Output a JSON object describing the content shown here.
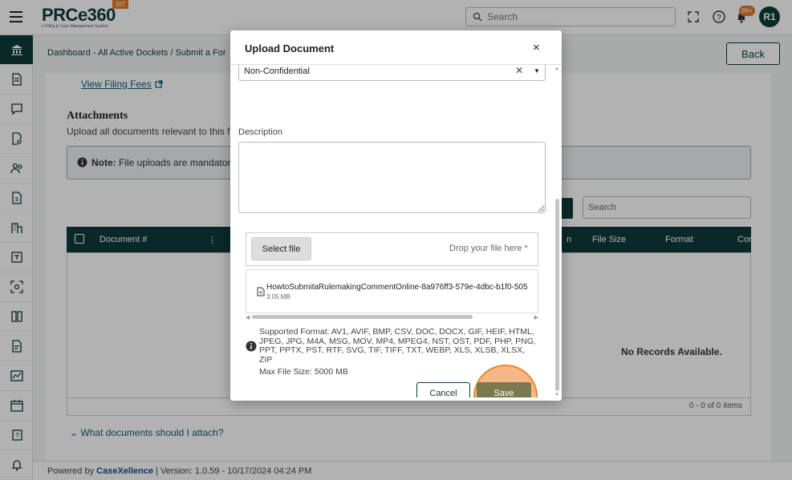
{
  "app": {
    "logo_text": "PRCe360",
    "logo_sub": "e-Filing & Case Management System",
    "env_badge": "SIT"
  },
  "topbar": {
    "search_placeholder": "Search",
    "notification_count": "99+",
    "avatar_initials": "R1"
  },
  "page": {
    "breadcrumb": "Dashboard - All Active Dockets / Submit a For",
    "back_label": "Back",
    "fees_link": "View Filing Fees",
    "attachments_title": "Attachments",
    "attachments_sub": "Upload all documents relevant to this f",
    "note_label": "Note:",
    "note_text": "File uploads are mandatory",
    "grid_search_placeholder": "Search",
    "columns": {
      "doc_num": "Document #",
      "n": "n",
      "file_size": "File Size",
      "format": "Format",
      "cor": "Cor"
    },
    "no_records": "No Records Available.",
    "pager": "0 - 0 of 0 items",
    "what_docs": "What documents should I attach?"
  },
  "footer": {
    "powered_by": "Powered by",
    "brand": "CaseXellence",
    "separator": "|",
    "version": "Version: 1.0.59 - 10/17/2024 04:24 PM"
  },
  "modal": {
    "title": "Upload Document",
    "close": "×",
    "confidentiality_value": "Non-Confidential",
    "description_label": "Description",
    "select_file_label": "Select file",
    "drop_text": "Drop your file here *",
    "file": {
      "name": "HowtoSubmitaRulemakingCommentOnline-8a976ff3-579e-4dbc-b1f0-505",
      "size": "3.05 MB"
    },
    "supported_formats": "Supported Format: AV1, AVIF, BMP, CSV, DOC, DOCX, GIF, HEIF, HTML, JPEG, JPG, M4A, MSG, MOV, MP4, MPEG4, NST, OST, PDF, PHP, PNG, PPT, PPTX, PST, RTF, SVG, TIF, TIFF, TXT, WEBP, XLS, XLSB, XLSX, ZIP",
    "max_size": "Max File Size: 5000 MB",
    "cancel_label": "Cancel",
    "save_label": "Save"
  },
  "colors": {
    "primary": "#0d3b3a",
    "accent": "#e07a2b",
    "save": "#7a7a4f",
    "highlight": "#f6aa6e"
  }
}
